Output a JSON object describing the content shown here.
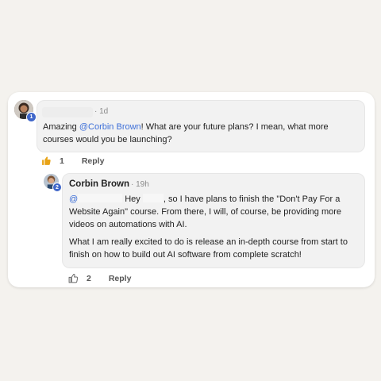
{
  "comment": {
    "time": "· 1d",
    "text_before": "Amazing ",
    "mention": "@Corbin Brown",
    "text_after": "! What are your future plans? I mean, what more courses would you be launching?",
    "badge": "1",
    "likes": "1",
    "reply_label": "Reply",
    "like_icon": "thumbs-up-filled"
  },
  "reply": {
    "author": "Corbin Brown",
    "time": "· 19h",
    "badge": "2",
    "mention_prefix": "@",
    "hey": "Hey",
    "para1_rest": ", so I have plans to finish the \"Don't Pay For a Website Again\" course. From there, I will, of course, be providing more videos on automations with AI.",
    "para2": "What I am really excited to do is release an in-depth course from start to finish on how to build out AI software from complete scratch!",
    "likes": "2",
    "reply_label": "Reply",
    "like_icon": "thumbs-up-outline"
  },
  "colors": {
    "background": "#f4f2ee",
    "card": "#ffffff",
    "bubble": "#f2f2f2",
    "mention": "#3d6fd8",
    "badge": "#3f66c9",
    "like_active": "#e8a317"
  }
}
